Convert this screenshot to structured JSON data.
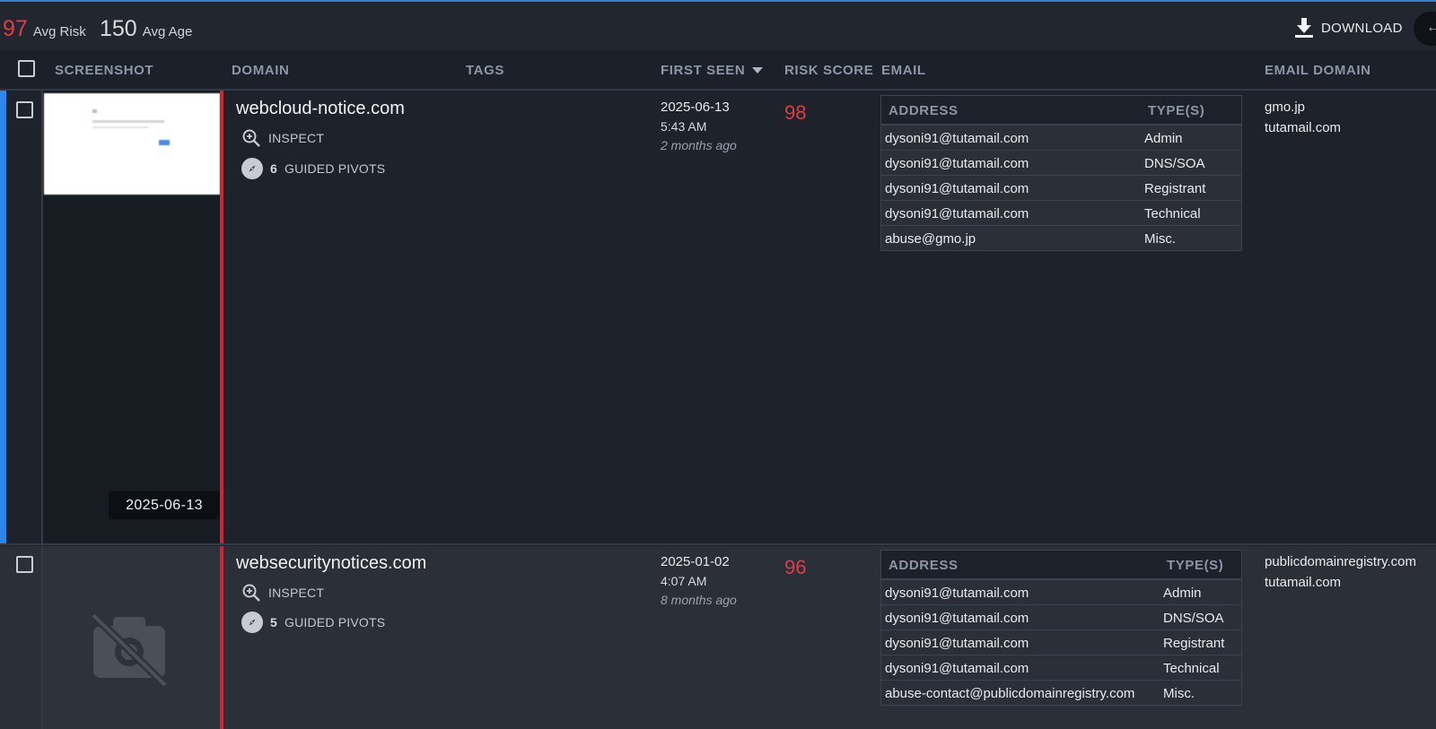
{
  "summary": {
    "avg_risk_value": "97",
    "avg_risk_label": "Avg Risk",
    "avg_age_value": "150",
    "avg_age_label": "Avg Age",
    "download_label": "DOWNLOAD"
  },
  "colors": {
    "accent": "#2e86e8",
    "risk": "#e03c46",
    "background": "#1e222b"
  },
  "columns": {
    "screenshot": "SCREENSHOT",
    "domain": "DOMAIN",
    "tags": "TAGS",
    "first_seen": "FIRST SEEN",
    "risk_score": "RISK SCORE",
    "email": "EMAIL",
    "email_domain": "EMAIL DOMAIN"
  },
  "email_table_headers": {
    "address": "ADDRESS",
    "types": "TYPE(S)"
  },
  "rows": [
    {
      "domain": "webcloud-notice.com",
      "inspect_label": "INSPECT",
      "pivots_count": "6",
      "pivots_label": "GUIDED PIVOTS",
      "screenshot_date": "2025-06-13",
      "first_seen_date": "2025-06-13",
      "first_seen_time": "5:43 AM",
      "first_seen_ago": "2 months ago",
      "risk_score": "98",
      "emails": [
        {
          "address": "dysoni91@tutamail.com",
          "type": "Admin"
        },
        {
          "address": "dysoni91@tutamail.com",
          "type": "DNS/SOA"
        },
        {
          "address": "dysoni91@tutamail.com",
          "type": "Registrant"
        },
        {
          "address": "dysoni91@tutamail.com",
          "type": "Technical"
        },
        {
          "address": "abuse@gmo.jp",
          "type": "Misc."
        }
      ],
      "email_domains": [
        "gmo.jp",
        "tutamail.com"
      ]
    },
    {
      "domain": "websecuritynotices.com",
      "inspect_label": "INSPECT",
      "pivots_count": "5",
      "pivots_label": "GUIDED PIVOTS",
      "first_seen_date": "2025-01-02",
      "first_seen_time": "4:07 AM",
      "first_seen_ago": "8 months ago",
      "risk_score": "96",
      "emails": [
        {
          "address": "dysoni91@tutamail.com",
          "type": "Admin"
        },
        {
          "address": "dysoni91@tutamail.com",
          "type": "DNS/SOA"
        },
        {
          "address": "dysoni91@tutamail.com",
          "type": "Registrant"
        },
        {
          "address": "dysoni91@tutamail.com",
          "type": "Technical"
        },
        {
          "address": "abuse-contact@publicdomainregistry.com",
          "type": "Misc."
        }
      ],
      "email_domains": [
        "publicdomainregistry.com",
        "tutamail.com"
      ]
    }
  ],
  "icons": {
    "download": "download-icon",
    "inspect": "magnifier-plus-icon",
    "pivots": "compass-icon",
    "no_screenshot": "camera-off-icon",
    "sort": "caret-down-icon"
  }
}
